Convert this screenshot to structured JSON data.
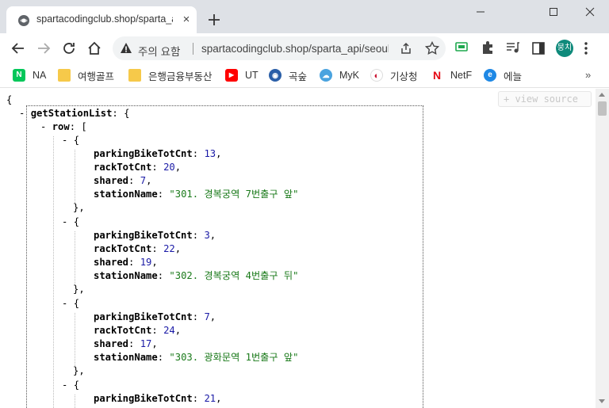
{
  "tab": {
    "title": "spartacodingclub.shop/sparta_api/seoulbike",
    "close": "×"
  },
  "window_controls": [
    "minimize",
    "maximize",
    "close"
  ],
  "omnibox": {
    "security_text": "주의 요함",
    "url": "spartacodingclub.shop/sparta_api/seoulbike"
  },
  "profile": {
    "initials": "뭉치"
  },
  "bookmarks": [
    {
      "label": "NA",
      "icon": "naver-icon",
      "color": "#03c75a",
      "glyph": "N"
    },
    {
      "label": "여행골프",
      "icon": "folder-icon",
      "color": "#f6c94a",
      "glyph": ""
    },
    {
      "label": "은행금융부동산",
      "icon": "folder-icon",
      "color": "#f6c94a",
      "glyph": ""
    },
    {
      "label": "UT",
      "icon": "youtube-icon",
      "color": "#ff0000",
      "glyph": "▶"
    },
    {
      "label": "곡숲",
      "icon": "globe-icon",
      "color": "#2b5fa8",
      "glyph": "◉"
    },
    {
      "label": "MyK",
      "icon": "cloud-icon",
      "color": "#4aa3df",
      "glyph": "☁"
    },
    {
      "label": "기상청",
      "icon": "korea-emblem-icon",
      "color": "#c8102e",
      "glyph": "◐"
    },
    {
      "label": "NetF",
      "icon": "netflix-icon",
      "color": "#e50914",
      "glyph": "N"
    },
    {
      "label": "에늘",
      "icon": "e-icon",
      "color": "#1e88e5",
      "glyph": "e"
    }
  ],
  "view_source": "+ view source",
  "json_view": {
    "open_brace": "{",
    "root_key": "getStationList",
    "row_key": "row",
    "stations": [
      {
        "parkingBikeTotCnt": "13",
        "rackTotCnt": "20",
        "shared": "7",
        "stationName": "\"301. 경복궁역 7번출구 앞\""
      },
      {
        "parkingBikeTotCnt": "3",
        "rackTotCnt": "22",
        "shared": "19",
        "stationName": "\"302. 경복궁역 4번출구 뒤\""
      },
      {
        "parkingBikeTotCnt": "7",
        "rackTotCnt": "24",
        "shared": "17",
        "stationName": "\"303. 광화문역 1번출구 앞\""
      },
      {
        "parkingBikeTotCnt": "21"
      }
    ]
  }
}
